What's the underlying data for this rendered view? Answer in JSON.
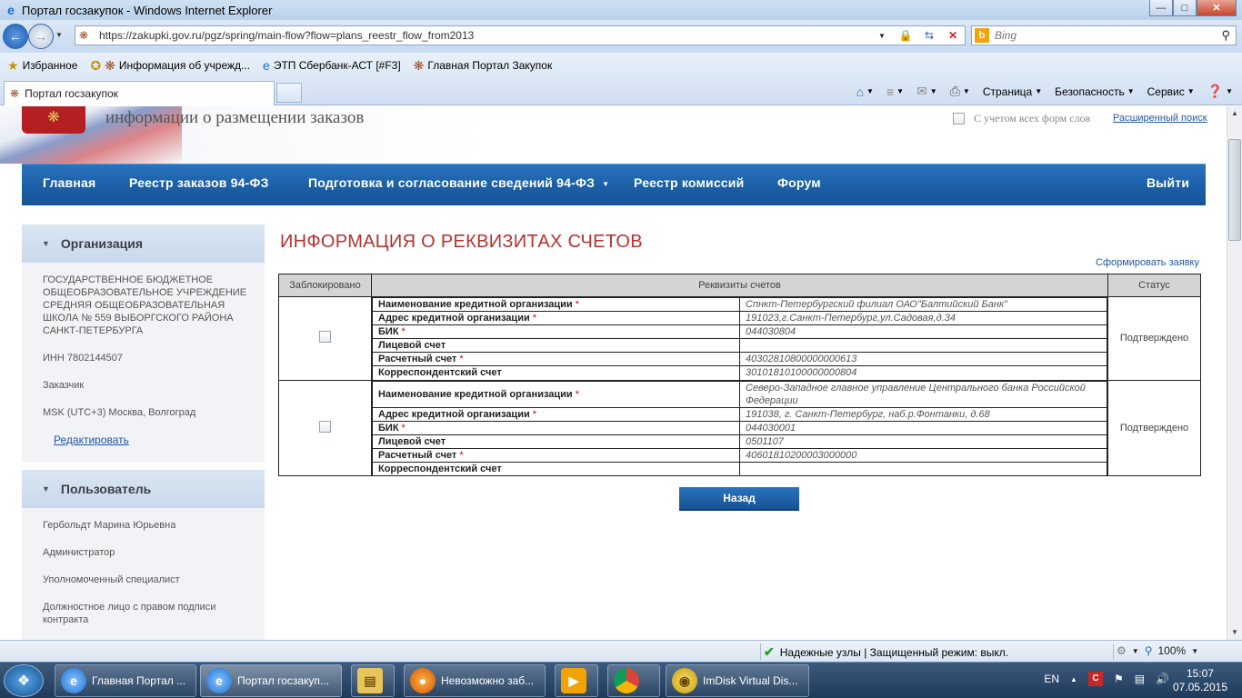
{
  "window": {
    "title": "Портал госзакупок - Windows Internet Explorer"
  },
  "addressbar": {
    "url": "https://zakupki.gov.ru/pgz/spring/main-flow?flow=plans_reestr_flow_from2013",
    "search_placeholder": "Bing"
  },
  "favorites": {
    "label": "Избранное",
    "items": [
      "Информация об учрежд...",
      "ЭТП Сбербанк-АСТ [#F3]",
      "Главная Портал Закупок"
    ]
  },
  "tabs": {
    "active_tab": "Портал госзакупок"
  },
  "commandbar": {
    "page": "Страница",
    "safety": "Безопасность",
    "tools": "Сервис"
  },
  "site": {
    "title": "информации о размещении заказов",
    "word_forms": "С учетом всех форм слов",
    "advanced_search": "Расширенный поиск"
  },
  "nav": {
    "items": [
      "Главная",
      "Реестр заказов 94-ФЗ",
      "Подготовка и согласование сведений 94-ФЗ",
      "Реестр комиссий",
      "Форум"
    ],
    "logout": "Выйти"
  },
  "sidebar": {
    "org": {
      "heading": "Организация",
      "name": "ГОСУДАРСТВЕННОЕ БЮДЖЕТНОЕ ОБЩЕОБРАЗОВАТЕЛЬНОЕ УЧРЕЖДЕНИЕ СРЕДНЯЯ ОБЩЕОБРАЗОВАТЕЛЬНАЯ ШКОЛА № 559 ВЫБОРГСКОГО РАЙОНА САНКТ-ПЕТЕРБУРГА",
      "inn": "ИНН 7802144507",
      "role": "Заказчик",
      "timezone": "MSK (UTC+3) Москва, Волгоград",
      "edit": "Редактировать"
    },
    "user": {
      "heading": "Пользователь",
      "name": "Гербольдт Марина Юрьевна",
      "roles": [
        "Администратор",
        "Уполномоченный специалист",
        "Должностное лицо с правом подписи контракта"
      ]
    }
  },
  "main": {
    "heading": "ИНФОРМАЦИЯ О РЕКВИЗИТАХ СЧЕТОВ",
    "form_request": "Сформировать заявку",
    "table": {
      "headers": [
        "Заблокировано",
        "Реквизиты счетов",
        "Статус"
      ],
      "required_mark": "*",
      "accounts": [
        {
          "status": "Подтверждено",
          "rows": [
            {
              "label": "Наименование кредитной организации",
              "required": "*",
              "value": "Спнкт-Петербургский филиал ОАО\"Балтийский Банк\""
            },
            {
              "label": "Адрес кредитной организации",
              "required": "*",
              "value": "191023,г.Санкт-Петербург,ул.Садовая,д.34"
            },
            {
              "label": "БИК",
              "required": "*",
              "value": "044030804"
            },
            {
              "label": "Лицевой счет",
              "required": "",
              "value": ""
            },
            {
              "label": "Расчетный счет",
              "required": "*",
              "value": "40302810800000000613"
            },
            {
              "label": "Корреспондентский счет",
              "required": "",
              "value": "30101810100000000804"
            }
          ]
        },
        {
          "status": "Подтверждено",
          "rows": [
            {
              "label": "Наименование кредитной организации",
              "required": "*",
              "value": "Северо-Западное главное управление Центрального банка Российской Федерации"
            },
            {
              "label": "Адрес кредитной организации",
              "required": "*",
              "value": "191038, г. Санкт-Петербург, наб.р.Фонтанки, д.68"
            },
            {
              "label": "БИК",
              "required": "*",
              "value": "044030001"
            },
            {
              "label": "Лицевой счет",
              "required": "",
              "value": "0501107"
            },
            {
              "label": "Расчетный счет",
              "required": "*",
              "value": "40601810200003000000"
            },
            {
              "label": "Корреспондентский счет",
              "required": "",
              "value": ""
            }
          ]
        }
      ]
    },
    "back": "Назад"
  },
  "statusbar": {
    "trust": "Надежные узлы | Защищенный режим: выкл.",
    "zoom": "100%"
  },
  "taskbar": {
    "items": [
      "Главная Портал ...",
      "Портал госзакуп...",
      "Невозможно заб...",
      "ImDisk Virtual Dis..."
    ],
    "lang": "EN",
    "time": "15:07",
    "date": "07.05.2015"
  }
}
